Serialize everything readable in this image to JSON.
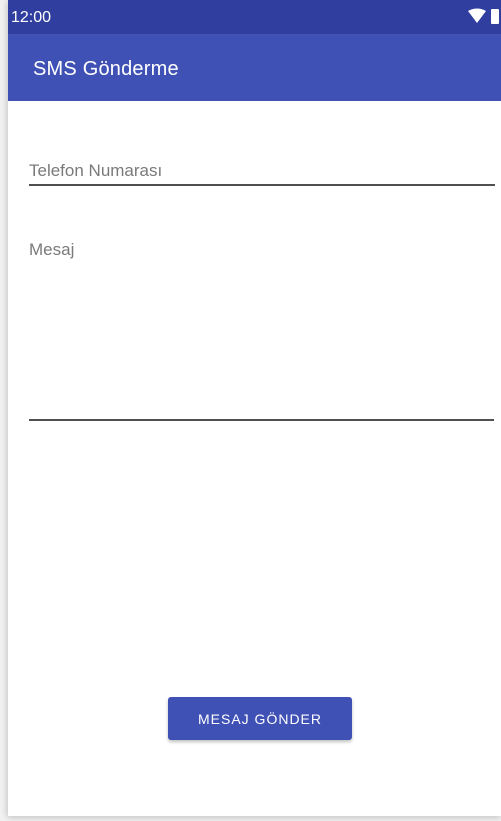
{
  "status_bar": {
    "time": "12:00",
    "icons": [
      "wifi-icon",
      "battery-icon"
    ],
    "background_color": "#303f9f"
  },
  "app_bar": {
    "title": "SMS Gönderme",
    "background_color": "#3f51b5"
  },
  "form": {
    "phone": {
      "placeholder": "Telefon Numarası",
      "value": ""
    },
    "message": {
      "placeholder": "Mesaj",
      "value": ""
    },
    "send_label": "MESAJ GÖNDER",
    "accent_color": "#3f51b5"
  }
}
